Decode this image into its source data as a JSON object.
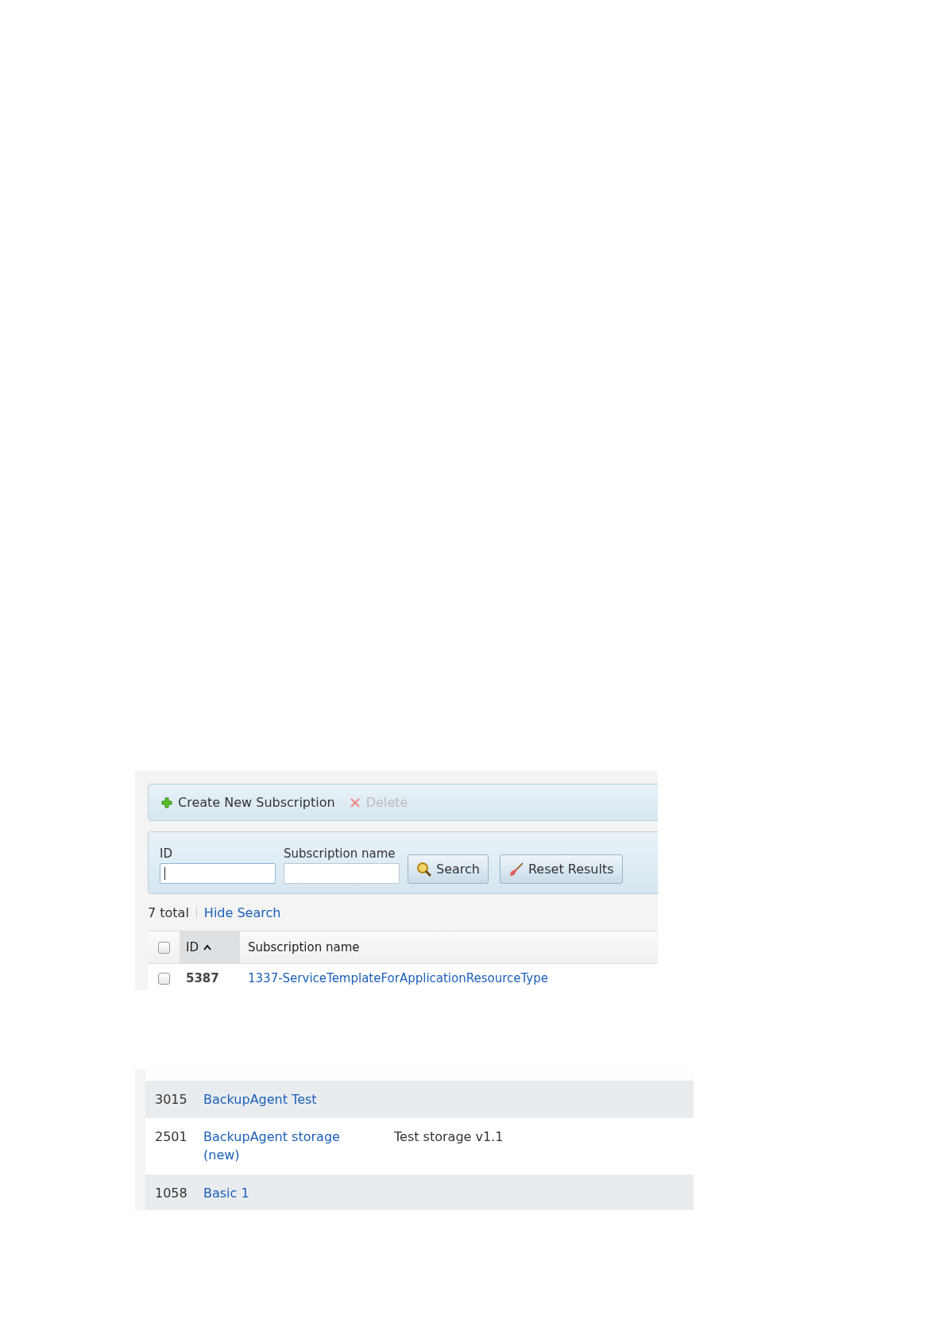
{
  "snippet_1": {
    "toolbar": [
      {
        "kind": "create",
        "label": "Create New Subscription",
        "disabled": false
      },
      {
        "kind": "delete",
        "label": "Delete",
        "disabled": true
      }
    ],
    "search_form": {
      "fields": [
        {
          "label": "ID",
          "focused": true
        },
        {
          "label": "Subscription name",
          "focused": false
        }
      ],
      "buttons": [
        {
          "kind": "search",
          "label": "Search"
        },
        {
          "kind": "reset",
          "label": "Reset Results"
        }
      ]
    },
    "summary": {
      "total": "7 total",
      "link": "Hide Search"
    },
    "table": {
      "select_all": {
        "checked": false
      },
      "columns": [
        {
          "label": "ID",
          "sorted": true
        },
        {
          "label": "Subscription name",
          "sorted": false
        }
      ],
      "rows": [
        {
          "checked": false,
          "id": "5387",
          "name": "1337-ServiceTemplateForApplicationResourceType"
        }
      ]
    }
  },
  "snippet_2": {
    "rows": [
      {
        "id": "3015",
        "name": "BackupAgent Test",
        "column_3": "",
        "shaded": true
      },
      {
        "id": "2501",
        "name": "BackupAgent storage (new)",
        "column_3": "Test storage v1.1",
        "shaded": false
      },
      {
        "id": "1058",
        "name": "Basic 1",
        "column_3": "",
        "shaded": true
      }
    ]
  }
}
